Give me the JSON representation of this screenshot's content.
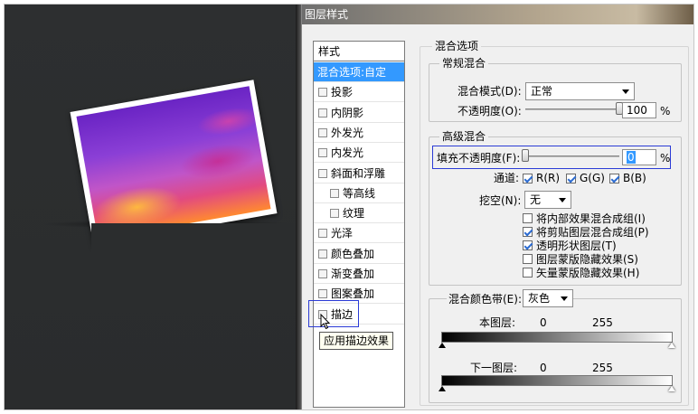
{
  "dialog": {
    "title": "图层样式",
    "styles_header": "样式",
    "items": [
      {
        "label": "混合选项:自定",
        "selected": true,
        "checkbox": false,
        "indent": false
      },
      {
        "label": "投影",
        "checkbox": true,
        "indent": false
      },
      {
        "label": "内阴影",
        "checkbox": true,
        "indent": false
      },
      {
        "label": "外发光",
        "checkbox": true,
        "indent": false
      },
      {
        "label": "内发光",
        "checkbox": true,
        "indent": false
      },
      {
        "label": "斜面和浮雕",
        "checkbox": true,
        "indent": false
      },
      {
        "label": "等高线",
        "checkbox": true,
        "indent": true
      },
      {
        "label": "纹理",
        "checkbox": true,
        "indent": true
      },
      {
        "label": "光泽",
        "checkbox": true,
        "indent": false
      },
      {
        "label": "颜色叠加",
        "checkbox": true,
        "indent": false
      },
      {
        "label": "渐变叠加",
        "checkbox": true,
        "indent": false
      },
      {
        "label": "图案叠加",
        "checkbox": true,
        "indent": false
      },
      {
        "label": "描边",
        "checkbox": true,
        "indent": false
      }
    ],
    "tooltip": "应用描边效果",
    "blend_options_title": "混合选项",
    "general_blend_title": "常规混合",
    "blend_mode_label": "混合模式(D):",
    "blend_mode_value": "正常",
    "opacity_label": "不透明度(O):",
    "opacity_value": "100",
    "percent": "%",
    "opacity_fraction": 1.0,
    "advanced_blend_title": "高级混合",
    "fill_opacity_label": "填充不透明度(F):",
    "fill_opacity_value": "0",
    "fill_opacity_fraction": 0.0,
    "channels_label": "通道:",
    "channels": [
      {
        "label": "R(R)",
        "checked": true
      },
      {
        "label": "G(G)",
        "checked": true
      },
      {
        "label": "B(B)",
        "checked": true
      }
    ],
    "knockout_label": "挖空(N):",
    "knockout_value": "无",
    "options": [
      {
        "label": "将内部效果混合成组(I)",
        "checked": false
      },
      {
        "label": "将剪贴图层混合成组(P)",
        "checked": true
      },
      {
        "label": "透明形状图层(T)",
        "checked": true
      },
      {
        "label": "图层蒙版隐藏效果(S)",
        "checked": false
      },
      {
        "label": "矢量蒙版隐藏效果(H)",
        "checked": false
      }
    ],
    "blend_if_label": "混合颜色带(E):",
    "blend_if_value": "灰色",
    "this_layer_label": "本图层:",
    "this_layer_min": "0",
    "this_layer_max": "255",
    "underlying_label": "下一图层:",
    "underlying_min": "0",
    "underlying_max": "255"
  }
}
